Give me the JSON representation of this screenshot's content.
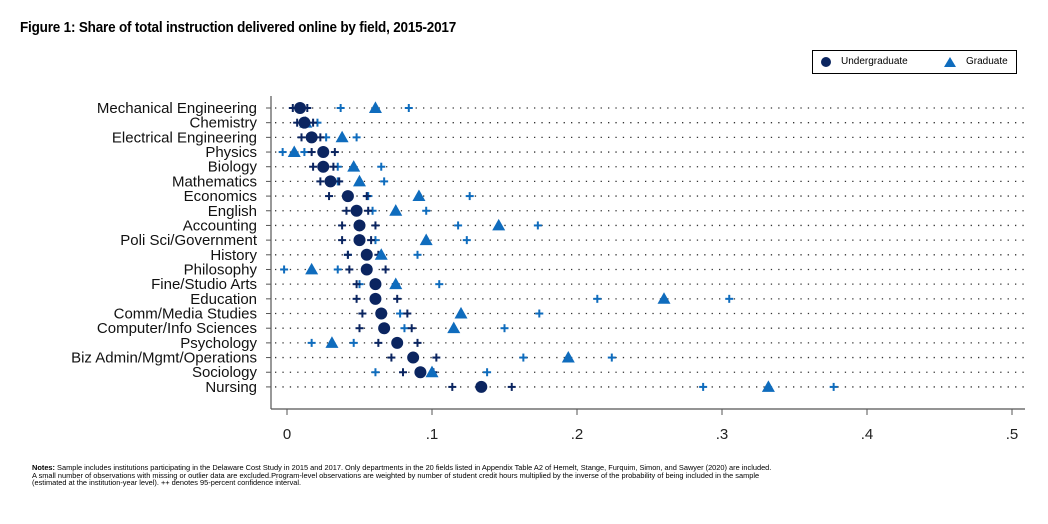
{
  "figure": {
    "title": "Figure 1: Share of total instruction delivered online by field, 2015-2017",
    "notes_label": "Notes:",
    "notes_lines": [
      " Sample includes institutions participating in the Delaware Cost Study in 2015 and 2017. Only departments in the 20 fields listed in Appendix Table A2 of Hemelt, Stange, Furquim, Simon, and Sawyer (2020) are included.",
      "A small number of observations with missing or outlier data are excluded.Program-level observations are weighted by number of student credit hours multiplied by the inverse of the probability of being included in the sample",
      "(estimated at the institution-year level). ++ denotes 95-percent confidence interval."
    ]
  },
  "legend": {
    "placement": "top-right",
    "items": [
      {
        "label": "Undergraduate",
        "marker": "circle",
        "color": "#0b2560"
      },
      {
        "label": "Graduate",
        "marker": "triangle",
        "color": "#0f6cbd"
      }
    ]
  },
  "colors": {
    "undergraduate": "#0b2560",
    "graduate": "#0f6cbd",
    "axis": "#555555",
    "guide_dots": "#333333"
  },
  "chart_data": {
    "type": "scatter",
    "subtype": "dot-plot with 95% confidence intervals",
    "title": "Figure 1: Share of total instruction delivered online by field, 2015-2017",
    "xlabel": "",
    "ylabel": "",
    "xlim": [
      0,
      0.5
    ],
    "xticks": [
      0,
      0.1,
      0.2,
      0.3,
      0.4,
      0.5
    ],
    "xtick_labels": [
      "0",
      ".1",
      ".2",
      ".3",
      ".4",
      ".5"
    ],
    "grid": "dotted horizontal guide lines per category",
    "legend": "top-right",
    "categories": [
      "Mechanical Engineering",
      "Chemistry",
      "Electrical Engineering",
      "Physics",
      "Biology",
      "Mathematics",
      "Economics",
      "English",
      "Accounting",
      "Poli Sci/Government",
      "History",
      "Philosophy",
      "Fine/Studio Arts",
      "Education",
      "Comm/Media Studies",
      "Computer/Info Sciences",
      "Psychology",
      "Biz Admin/Mgmt/Operations",
      "Sociology",
      "Nursing"
    ],
    "series": [
      {
        "name": "Undergraduate",
        "marker": "circle",
        "values": [
          0.009,
          0.012,
          0.017,
          0.025,
          0.025,
          0.03,
          0.042,
          0.048,
          0.05,
          0.05,
          0.055,
          0.055,
          0.061,
          0.061,
          0.065,
          0.067,
          0.076,
          0.087,
          0.092,
          0.134
        ],
        "ci_low": [
          0.004,
          0.007,
          0.01,
          0.017,
          0.018,
          0.023,
          0.029,
          0.041,
          0.038,
          0.038,
          0.042,
          0.043,
          0.048,
          0.048,
          0.052,
          0.05,
          0.063,
          0.072,
          0.08,
          0.114
        ],
        "ci_high": [
          0.014,
          0.018,
          0.023,
          0.033,
          0.032,
          0.036,
          0.055,
          0.056,
          0.061,
          0.058,
          0.063,
          0.068,
          0.075,
          0.076,
          0.083,
          0.086,
          0.09,
          0.103,
          0.101,
          0.155
        ]
      },
      {
        "name": "Graduate",
        "marker": "triangle",
        "values": [
          0.061,
          0.013,
          0.038,
          0.005,
          0.046,
          0.05,
          0.091,
          0.075,
          0.146,
          0.096,
          0.065,
          0.017,
          0.075,
          0.26,
          0.12,
          0.115,
          0.031,
          0.194,
          0.1,
          0.332
        ],
        "ci_low": [
          0.037,
          0.011,
          0.027,
          -0.003,
          0.035,
          0.035,
          0.056,
          0.059,
          0.118,
          0.061,
          0.042,
          -0.002,
          0.05,
          0.214,
          0.078,
          0.081,
          0.017,
          0.163,
          0.061,
          0.287
        ],
        "ci_high": [
          0.084,
          0.021,
          0.048,
          0.012,
          0.065,
          0.067,
          0.126,
          0.096,
          0.173,
          0.124,
          0.09,
          0.035,
          0.105,
          0.305,
          0.174,
          0.15,
          0.046,
          0.224,
          0.138,
          0.377
        ]
      }
    ]
  }
}
